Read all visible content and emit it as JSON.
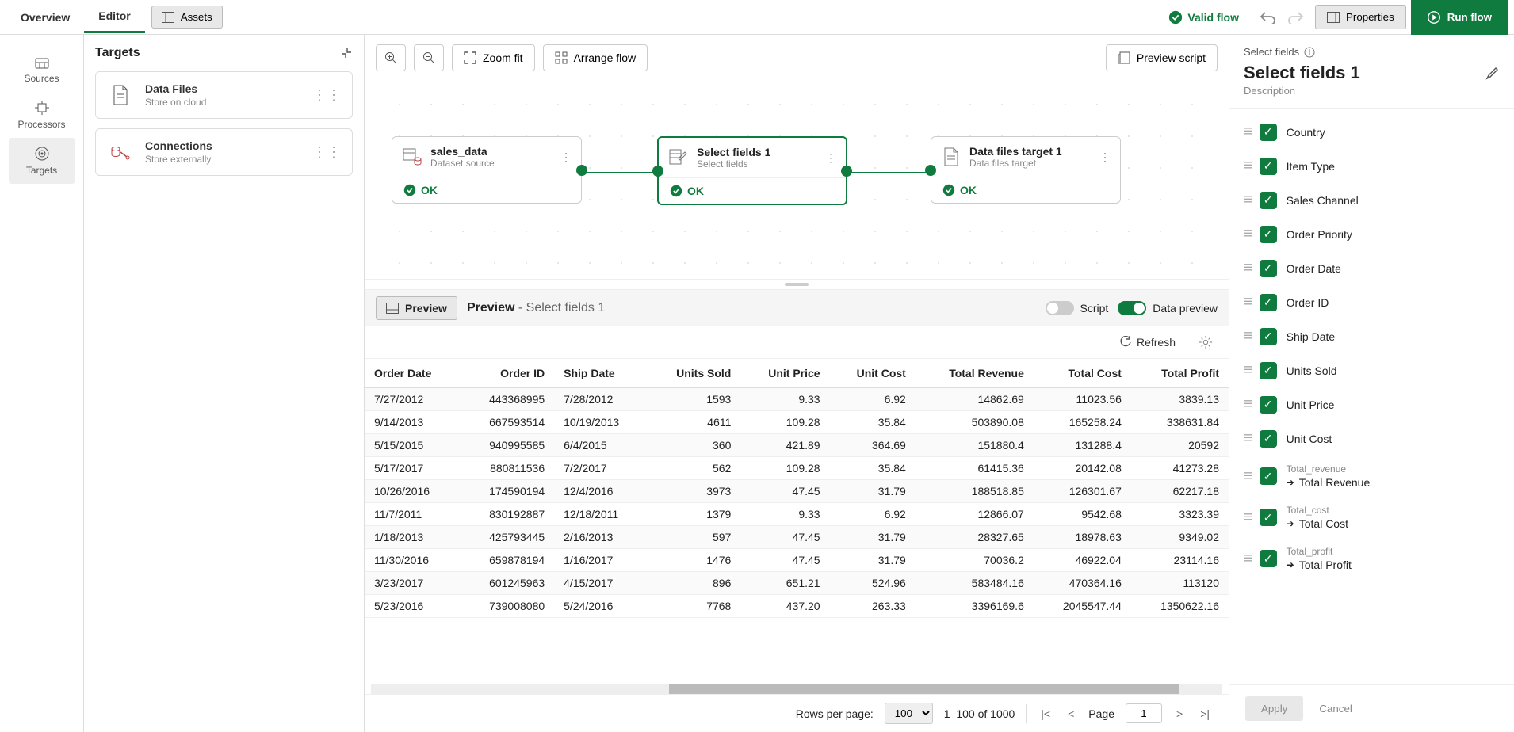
{
  "topbar": {
    "tabs": [
      "Overview",
      "Editor"
    ],
    "assets": "Assets",
    "valid_flow": "Valid flow",
    "properties": "Properties",
    "run": "Run flow"
  },
  "leftrail": {
    "items": [
      "Sources",
      "Processors",
      "Targets"
    ]
  },
  "targets_panel": {
    "title": "Targets",
    "cards": [
      {
        "title": "Data Files",
        "sub": "Store on cloud"
      },
      {
        "title": "Connections",
        "sub": "Store externally"
      }
    ]
  },
  "canvas_toolbar": {
    "zoom_fit": "Zoom fit",
    "arrange": "Arrange flow",
    "preview_script": "Preview script"
  },
  "nodes": [
    {
      "title": "sales_data",
      "sub": "Dataset source",
      "status": "OK"
    },
    {
      "title": "Select fields 1",
      "sub": "Select fields",
      "status": "OK"
    },
    {
      "title": "Data files target 1",
      "sub": "Data files target",
      "status": "OK"
    }
  ],
  "preview_bar": {
    "badge": "Preview",
    "title": "Preview",
    "context": " - Select fields 1",
    "script": "Script",
    "data_preview": "Data preview"
  },
  "refresh": "Refresh",
  "table": {
    "columns": [
      "Order Date",
      "Order ID",
      "Ship Date",
      "Units Sold",
      "Unit Price",
      "Unit Cost",
      "Total Revenue",
      "Total Cost",
      "Total Profit"
    ],
    "rows": [
      [
        "7/27/2012",
        "443368995",
        "7/28/2012",
        "1593",
        "9.33",
        "6.92",
        "14862.69",
        "11023.56",
        "3839.13"
      ],
      [
        "9/14/2013",
        "667593514",
        "10/19/2013",
        "4611",
        "109.28",
        "35.84",
        "503890.08",
        "165258.24",
        "338631.84"
      ],
      [
        "5/15/2015",
        "940995585",
        "6/4/2015",
        "360",
        "421.89",
        "364.69",
        "151880.4",
        "131288.4",
        "20592"
      ],
      [
        "5/17/2017",
        "880811536",
        "7/2/2017",
        "562",
        "109.28",
        "35.84",
        "61415.36",
        "20142.08",
        "41273.28"
      ],
      [
        "10/26/2016",
        "174590194",
        "12/4/2016",
        "3973",
        "47.45",
        "31.79",
        "188518.85",
        "126301.67",
        "62217.18"
      ],
      [
        "11/7/2011",
        "830192887",
        "12/18/2011",
        "1379",
        "9.33",
        "6.92",
        "12866.07",
        "9542.68",
        "3323.39"
      ],
      [
        "1/18/2013",
        "425793445",
        "2/16/2013",
        "597",
        "47.45",
        "31.79",
        "28327.65",
        "18978.63",
        "9349.02"
      ],
      [
        "11/30/2016",
        "659878194",
        "1/16/2017",
        "1476",
        "47.45",
        "31.79",
        "70036.2",
        "46922.04",
        "23114.16"
      ],
      [
        "3/23/2017",
        "601245963",
        "4/15/2017",
        "896",
        "651.21",
        "524.96",
        "583484.16",
        "470364.16",
        "113120"
      ],
      [
        "5/23/2016",
        "739008080",
        "5/24/2016",
        "7768",
        "437.20",
        "263.33",
        "3396169.6",
        "2045547.44",
        "1350622.16"
      ]
    ]
  },
  "pager": {
    "rows_per_page_label": "Rows per page:",
    "rows_per_page": "100",
    "range": "1–100 of 1000",
    "page_label": "Page",
    "page": "1"
  },
  "rightpanel": {
    "crumb": "Select fields",
    "title": "Select fields 1",
    "desc": "Description",
    "fields": [
      {
        "label": "Country"
      },
      {
        "label": "Item Type"
      },
      {
        "label": "Sales Channel"
      },
      {
        "label": "Order Priority"
      },
      {
        "label": "Order Date"
      },
      {
        "label": "Order ID"
      },
      {
        "label": "Ship Date"
      },
      {
        "label": "Units Sold"
      },
      {
        "label": "Unit Price"
      },
      {
        "label": "Unit Cost"
      },
      {
        "label": "Total Revenue",
        "orig": "Total_revenue"
      },
      {
        "label": "Total Cost",
        "orig": "Total_cost"
      },
      {
        "label": "Total Profit",
        "orig": "Total_profit"
      }
    ],
    "apply": "Apply",
    "cancel": "Cancel"
  }
}
